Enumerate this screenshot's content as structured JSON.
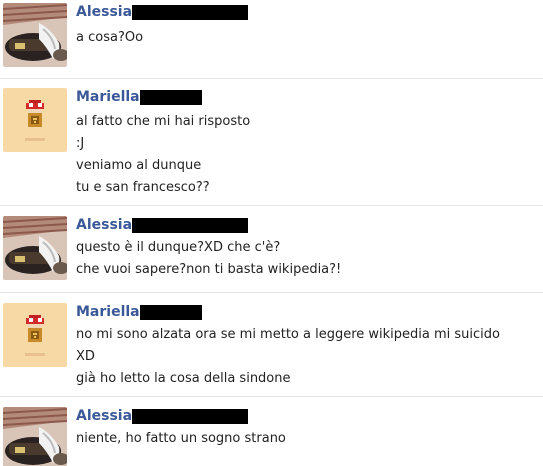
{
  "messages": [
    {
      "sender": "Alessia",
      "avatar": "alessia-avatar",
      "lines": [
        "a cosa?Oo"
      ]
    },
    {
      "sender": "Mariella",
      "avatar": "mario-mushroom-avatar",
      "lines": [
        "al fatto che mi hai risposto",
        ":J",
        "veniamo al dunque",
        "tu e san francesco??"
      ]
    },
    {
      "sender": "Alessia",
      "avatar": "alessia-avatar",
      "lines": [
        "questo è il dunque?XD che c'è?",
        "che vuoi sapere?non ti basta wikipedia?!"
      ]
    },
    {
      "sender": "Mariella",
      "avatar": "mario-mushroom-avatar",
      "lines": [
        "no mi sono alzata ora se mi metto a leggere wikipedia mi suicido",
        "XD",
        "già ho letto la cosa della sindone"
      ]
    },
    {
      "sender": "Alessia",
      "avatar": "alessia-avatar",
      "lines": [
        "niente, ho fatto un sogno strano"
      ]
    }
  ],
  "colors": {
    "sender_name": "#3b5998",
    "message_text": "#222222",
    "divider": "#e5e5e5",
    "redaction": "#000000"
  }
}
